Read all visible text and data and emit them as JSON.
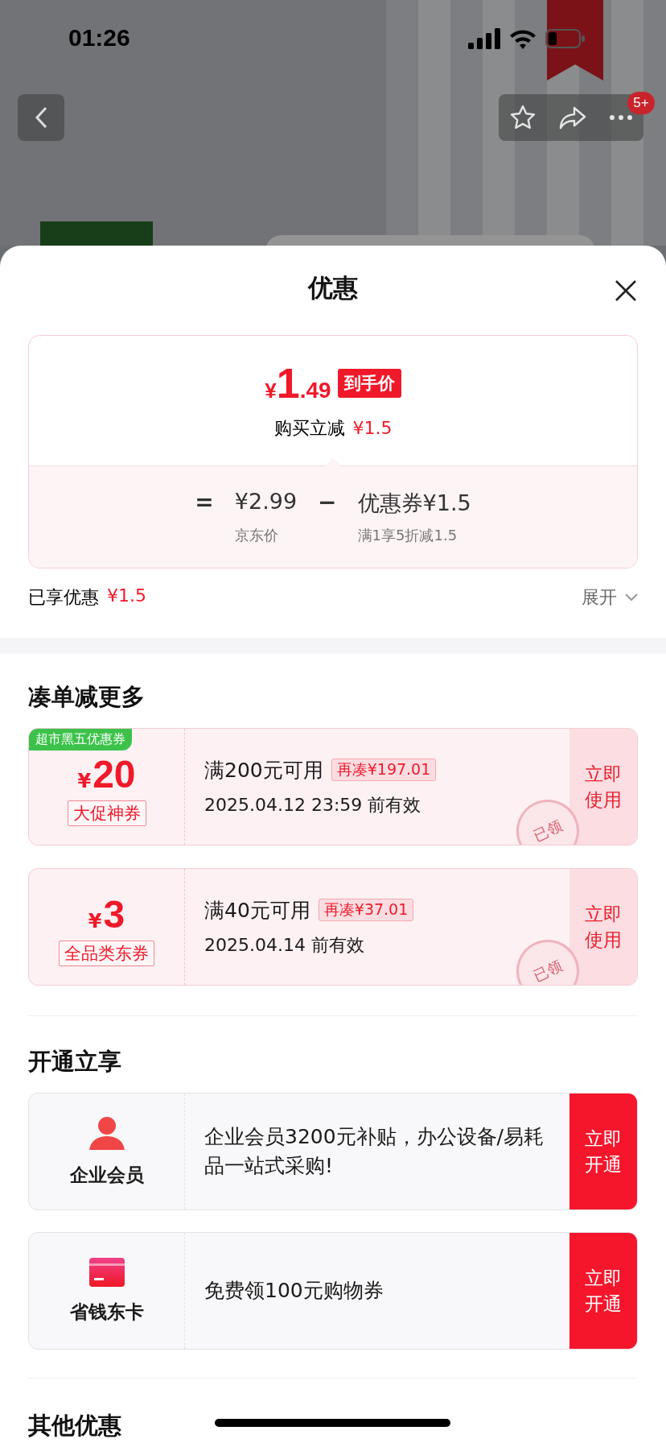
{
  "status_bar": {
    "time": "01:26"
  },
  "nav": {
    "badge": "5+"
  },
  "sheet": {
    "title": "优惠",
    "price_card": {
      "currency": "¥",
      "integer": "1",
      "decimal": ".49",
      "price_tag": "到手价",
      "instant_label": "购买立减",
      "instant_amount": "¥1.5",
      "equals": "=",
      "base_price": "¥2.99",
      "base_label": "京东价",
      "minus": "−",
      "coupon_value": "优惠券¥1.5",
      "coupon_rule": "满1享5折减1.5"
    },
    "enjoyed": {
      "label": "已享优惠",
      "amount": "¥1.5",
      "expand": "展开"
    },
    "coupon_section": {
      "title": "凑单减更多",
      "coupons": [
        {
          "tag": "超市黑五优惠券",
          "currency": "¥",
          "amount": "20",
          "label": "大促神券",
          "condition": "满200元可用",
          "gap": "再凑¥197.01",
          "expiry": "2025.04.12 23:59 前有效",
          "stamp": "已领",
          "action": "立即使用"
        },
        {
          "currency": "¥",
          "amount": "3",
          "label": "全品类东券",
          "condition": "满40元可用",
          "gap": "再凑¥37.01",
          "expiry": "2025.04.14 前有效",
          "stamp": "已领",
          "action": "立即使用"
        }
      ]
    },
    "member_section": {
      "title": "开通立享",
      "offers": [
        {
          "kind": "person",
          "name": "企业会员",
          "description": "企业会员3200元补贴，办公设备/易耗品一站式采购!",
          "action": "立即开通"
        },
        {
          "kind": "card",
          "name": "省钱东卡",
          "description": "免费领100元购物券",
          "action": "立即开通"
        }
      ]
    },
    "other_section": {
      "title": "其他优惠"
    }
  }
}
